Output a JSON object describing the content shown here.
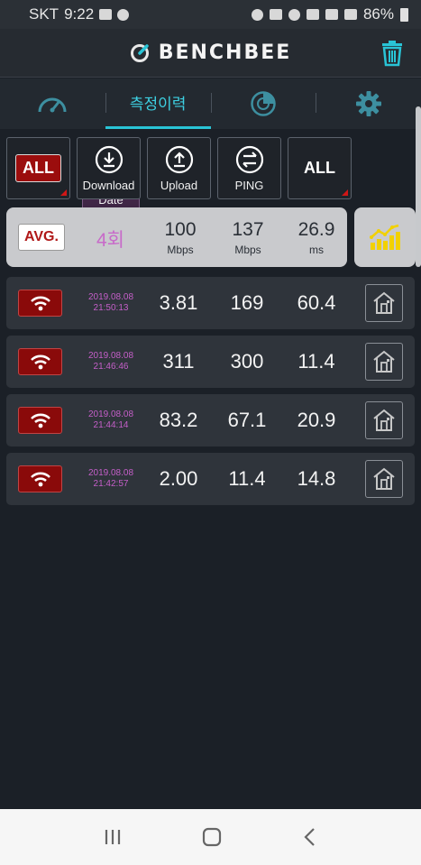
{
  "status_bar": {
    "carrier": "SKT",
    "time": "9:22",
    "battery": "86%"
  },
  "app": {
    "name": "BENCHBEE"
  },
  "tabs": [
    {
      "name": "speed-tab",
      "label": ""
    },
    {
      "name": "history-tab",
      "label": "측정이력"
    },
    {
      "name": "coverage-tab",
      "label": ""
    },
    {
      "name": "settings-tab",
      "label": ""
    }
  ],
  "filters": {
    "network_all": "ALL",
    "date": "Date",
    "download": "Download",
    "upload": "Upload",
    "ping": "PING",
    "type_all": "ALL"
  },
  "average": {
    "badge": "AVG.",
    "count": "4회",
    "download": {
      "value": "100",
      "unit": "Mbps"
    },
    "upload": {
      "value": "137",
      "unit": "Mbps"
    },
    "ping": {
      "value": "26.9",
      "unit": "ms"
    }
  },
  "records": [
    {
      "date": "2019.08.08",
      "time": "21:50:13",
      "download": "3.81",
      "upload": "169",
      "ping": "60.4"
    },
    {
      "date": "2019.08.08",
      "time": "21:46:46",
      "download": "311",
      "upload": "300",
      "ping": "11.4"
    },
    {
      "date": "2019.08.08",
      "time": "21:44:14",
      "download": "83.2",
      "upload": "67.1",
      "ping": "20.9"
    },
    {
      "date": "2019.08.08",
      "time": "21:42:57",
      "download": "2.00",
      "upload": "11.4",
      "ping": "14.8"
    }
  ],
  "colors": {
    "accent": "#29c4d6",
    "badge_red": "#8a0a0a",
    "date_pink": "#c55fc9"
  }
}
